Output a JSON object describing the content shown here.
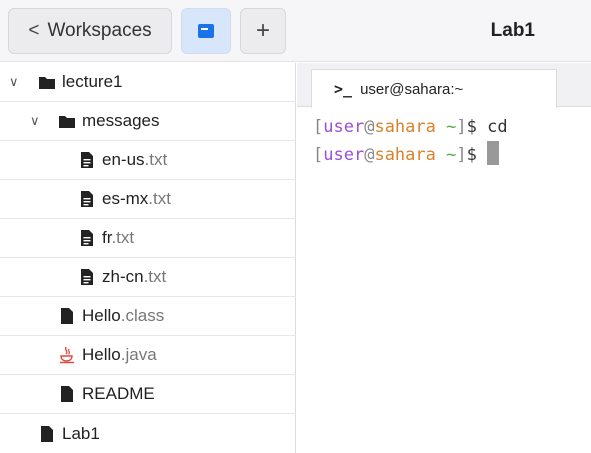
{
  "header": {
    "workspaces_label": "Workspaces",
    "title": "Lab1"
  },
  "tree": {
    "items": [
      {
        "name": "lecture1",
        "ext": "",
        "type": "folder"
      },
      {
        "name": "messages",
        "ext": "",
        "type": "folder"
      },
      {
        "name": "en-us",
        "ext": ".txt",
        "type": "text-file"
      },
      {
        "name": "es-mx",
        "ext": ".txt",
        "type": "text-file"
      },
      {
        "name": "fr",
        "ext": ".txt",
        "type": "text-file"
      },
      {
        "name": "zh-cn",
        "ext": ".txt",
        "type": "text-file"
      },
      {
        "name": "Hello",
        "ext": ".class",
        "type": "file"
      },
      {
        "name": "Hello",
        "ext": ".java",
        "type": "java-file"
      },
      {
        "name": "README",
        "ext": "",
        "type": "file"
      },
      {
        "name": "Lab1",
        "ext": "",
        "type": "file"
      }
    ]
  },
  "terminal": {
    "tab_label": "user@sahara:~",
    "prompt_user": "user",
    "prompt_at": "@",
    "prompt_host": "sahara",
    "prompt_dir": "~",
    "lines": [
      {
        "command": "cd"
      },
      {
        "command": ""
      }
    ]
  },
  "colors": {
    "user": "#9b4fd4",
    "host": "#d9822b",
    "dir": "#5aa54a",
    "active_button": "#d8e6fb",
    "java_icon": "#e0463a"
  }
}
